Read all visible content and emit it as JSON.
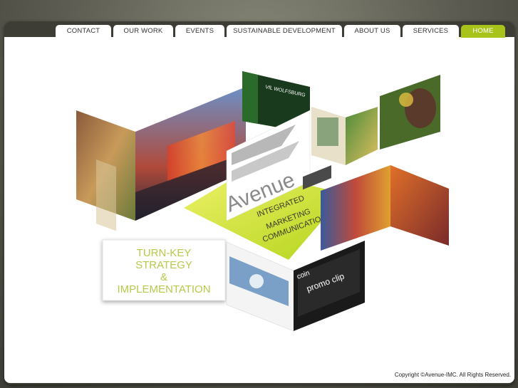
{
  "nav": {
    "tabs": [
      {
        "label": "CONTACT"
      },
      {
        "label": "OUR WORK"
      },
      {
        "label": "EVENTS"
      },
      {
        "label": "SUSTAINABLE DEVELOPMENT"
      },
      {
        "label": "ABOUT US"
      },
      {
        "label": "SERVICES"
      },
      {
        "label": "HOME"
      }
    ],
    "active_tab": "HOME",
    "accent_color": "#a8c31a"
  },
  "hero": {
    "logo_text": "Avenue",
    "tagline": [
      "INTEGRATED",
      "MARKETING",
      "COMMUNICATIONS"
    ],
    "box_lines": [
      "TURN-KEY",
      "STRATEGY",
      "&",
      "IMPLEMENTATION"
    ],
    "panel_text": {
      "wolfsburg": "VfL WOLFSBURG",
      "promo_brand": "coin",
      "promo": "promo clip"
    }
  },
  "footer": {
    "copyright": "Copyright ©Avenue-IMC. All Rights Reserved."
  }
}
